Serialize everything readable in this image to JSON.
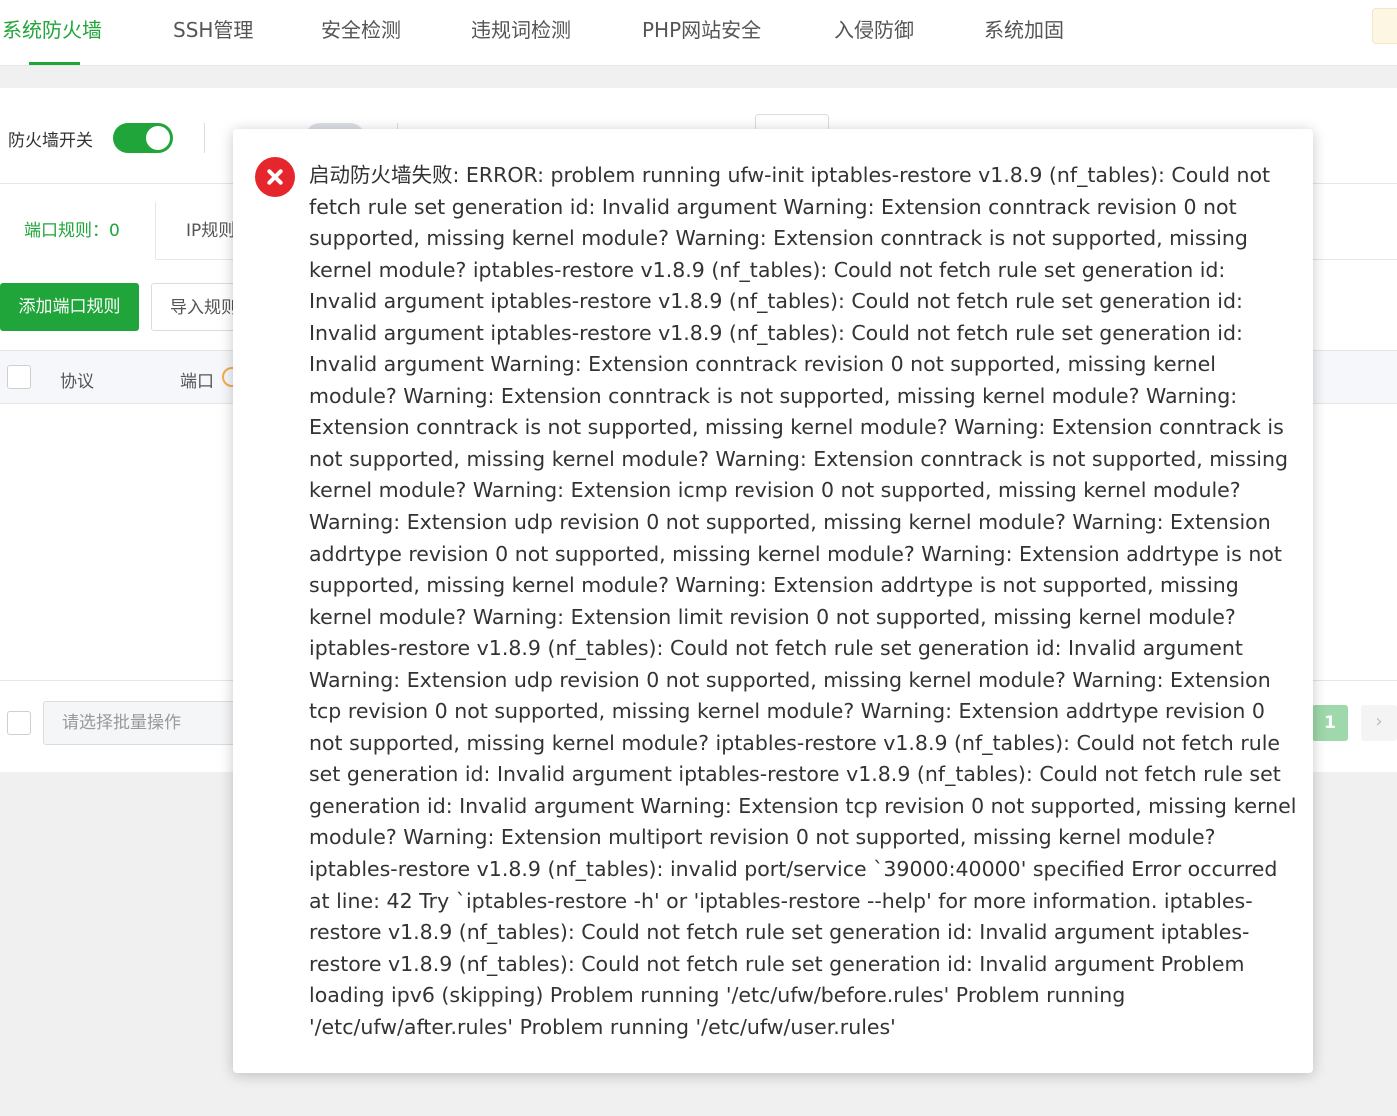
{
  "top_tabs": [
    {
      "label": "系统防火墙",
      "active": true
    },
    {
      "label": "SSH管理"
    },
    {
      "label": "安全检测"
    },
    {
      "label": "违规词检测"
    },
    {
      "label": "PHP网站安全"
    },
    {
      "label": "入侵防御"
    },
    {
      "label": "系统加固"
    }
  ],
  "firewall": {
    "switch_label": "防火墙开关",
    "enabled": true
  },
  "sub_tabs": [
    {
      "label": "端口规则：0",
      "active": true
    },
    {
      "label": "IP规则"
    }
  ],
  "toolbar": {
    "add_label": "添加端口规则",
    "import_label": "导入规则"
  },
  "table": {
    "headers": [
      "协议",
      "端口"
    ]
  },
  "footer": {
    "batch_placeholder": "请选择批量操作",
    "current_page": "1",
    "next_icon": "chevron-right-icon"
  },
  "dialog": {
    "icon": "error-icon",
    "message": "启动防火墙失败: ERROR: problem running ufw-init iptables-restore v1.8.9 (nf_tables): Could not fetch rule set generation id: Invalid argument Warning: Extension conntrack revision 0 not supported, missing kernel module? Warning: Extension conntrack is not supported, missing kernel module? iptables-restore v1.8.9 (nf_tables): Could not fetch rule set generation id: Invalid argument iptables-restore v1.8.9 (nf_tables): Could not fetch rule set generation id: Invalid argument iptables-restore v1.8.9 (nf_tables): Could not fetch rule set generation id: Invalid argument Warning: Extension conntrack revision 0 not supported, missing kernel module? Warning: Extension conntrack is not supported, missing kernel module? Warning: Extension conntrack is not supported, missing kernel module? Warning: Extension conntrack is not supported, missing kernel module? Warning: Extension conntrack is not supported, missing kernel module? Warning: Extension icmp revision 0 not supported, missing kernel module? Warning: Extension udp revision 0 not supported, missing kernel module? Warning: Extension addrtype revision 0 not supported, missing kernel module? Warning: Extension addrtype is not supported, missing kernel module? Warning: Extension addrtype is not supported, missing kernel module? Warning: Extension limit revision 0 not supported, missing kernel module? iptables-restore v1.8.9 (nf_tables): Could not fetch rule set generation id: Invalid argument Warning: Extension udp revision 0 not supported, missing kernel module? Warning: Extension tcp revision 0 not supported, missing kernel module? Warning: Extension addrtype revision 0 not supported, missing kernel module? iptables-restore v1.8.9 (nf_tables): Could not fetch rule set generation id: Invalid argument iptables-restore v1.8.9 (nf_tables): Could not fetch rule set generation id: Invalid argument Warning: Extension tcp revision 0 not supported, missing kernel module? Warning: Extension multiport revision 0 not supported, missing kernel module? iptables-restore v1.8.9 (nf_tables): invalid port/service `39000:40000' specified Error occurred at line: 42 Try `iptables-restore -h' or 'iptables-restore --help' for more information. iptables-restore v1.8.9 (nf_tables): Could not fetch rule set generation id: Invalid argument iptables-restore v1.8.9 (nf_tables): Could not fetch rule set generation id: Invalid argument Problem loading ipv6 (skipping) Problem running '/etc/ufw/before.rules' Problem running '/etc/ufw/after.rules' Problem running '/etc/ufw/user.rules'"
  },
  "colors": {
    "accent": "#20a53a",
    "error": "#e5262c",
    "page_active": "#9fd8ab"
  }
}
